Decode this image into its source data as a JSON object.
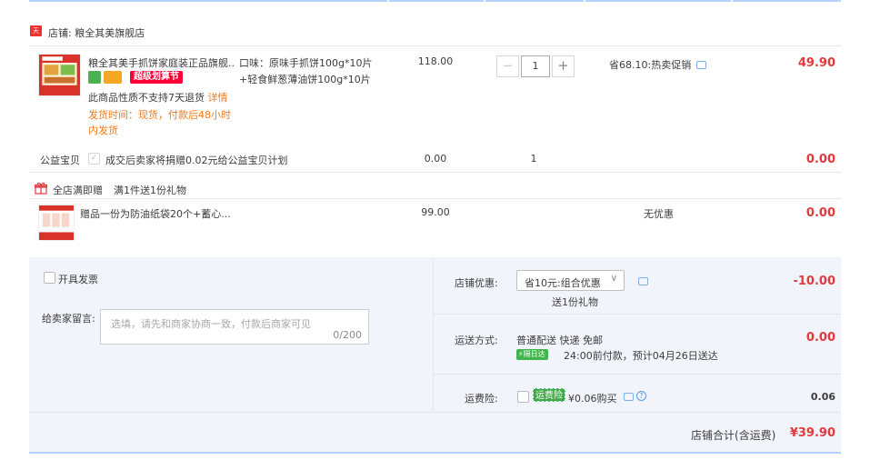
{
  "store": {
    "icon_text": "天猫",
    "label": "店铺: 粮全其美旗舰店"
  },
  "item": {
    "title": "粮全其美手抓饼家庭装正品旗舰...",
    "promo_badge": "超级划算节",
    "flavor_line1": "口味：原味手抓饼100g*10片",
    "flavor_line2": "+轻食鲜葱薄油饼100g*10片",
    "unit_price": "118.00",
    "quantity": "1",
    "discount": "省68.10:热卖促销",
    "subtotal": "49.90",
    "return_note": "此商品性质不支持7天退货",
    "return_link": "详情",
    "ship_line1": "发货时间：现货，付款后48小时",
    "ship_line2": "内发货"
  },
  "charity": {
    "label": "公益宝贝",
    "text": "成交后卖家将捐赠0.02元给公益宝贝计划",
    "price": "0.00",
    "qty": "1",
    "subtotal": "0.00"
  },
  "gift_promo": {
    "label": "全店满即赠",
    "text": "满1件送1份礼物"
  },
  "gift": {
    "title": "赠品一份为防油纸袋20个+蓄心...",
    "price": "99.00",
    "discount": "无优惠",
    "subtotal": "0.00"
  },
  "invoice": {
    "label": "开具发票"
  },
  "message": {
    "label": "给卖家留言:",
    "placeholder": "选填，请先和商家协商一致，付款后商家可见",
    "counter": "0/200"
  },
  "shop_discount": {
    "label": "店铺优惠:",
    "selected": "省10元:组合优惠",
    "note": "送1份礼物",
    "amount": "-10.00"
  },
  "shipping": {
    "label": "运送方式:",
    "method": "普通配送 快递 免邮",
    "tag": "隔日达",
    "eta": "24:00前付款，预计04月26日送达",
    "amount": "0.00"
  },
  "insurance": {
    "label": "运费险:",
    "badge": "运费险",
    "price": "¥0.06购买",
    "amount": "0.06"
  },
  "total": {
    "label": "店铺合计(含运费)",
    "amount": "¥39.90"
  },
  "colors": {
    "accent_red": "#e4393c",
    "link_orange": "#f37b1d",
    "border_blue": "#b2d1ff",
    "panel_bg": "#f1f4fa"
  }
}
